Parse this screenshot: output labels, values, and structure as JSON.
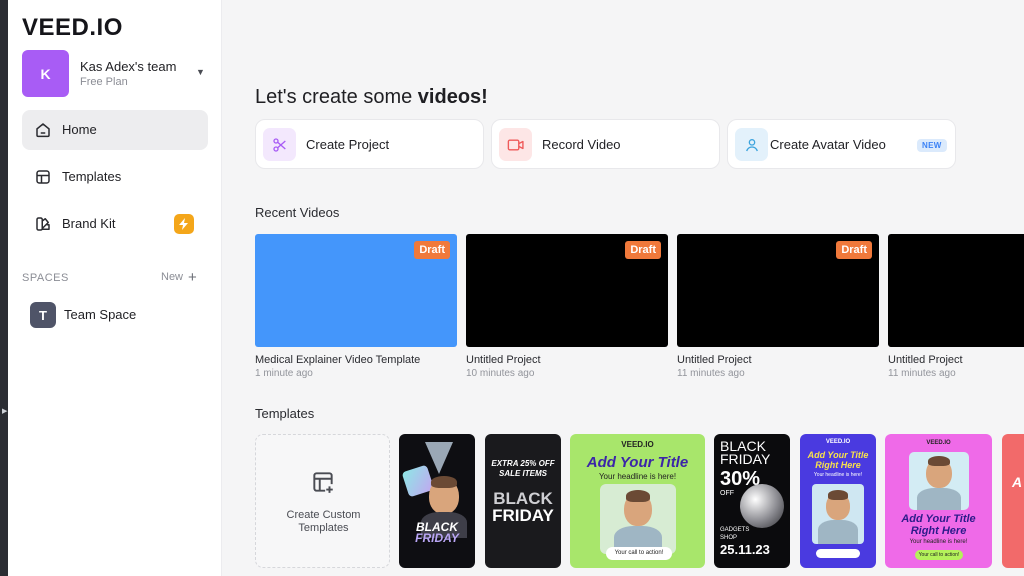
{
  "app": {
    "logo": "VEED.IO"
  },
  "team": {
    "initial": "K",
    "name": "Kas Adex's team",
    "plan": "Free Plan"
  },
  "nav": {
    "home": "Home",
    "templates": "Templates",
    "brand_kit": "Brand Kit"
  },
  "spaces": {
    "title": "SPACES",
    "new_label": "New",
    "items": [
      {
        "initial": "T",
        "label": "Team Space"
      }
    ]
  },
  "main": {
    "heading_prefix": "Let's create some ",
    "heading_bold": "videos!",
    "actions": {
      "create_project": "Create Project",
      "record_video": "Record Video",
      "create_avatar": "Create Avatar Video",
      "new_badge": "NEW"
    },
    "recent_title": "Recent Videos",
    "videos": [
      {
        "title": "Medical Explainer Video Template",
        "time": "1 minute ago",
        "badge": "Draft"
      },
      {
        "title": "Untitled Project",
        "time": "10 minutes ago",
        "badge": "Draft"
      },
      {
        "title": "Untitled Project",
        "time": "11 minutes ago",
        "badge": "Draft"
      },
      {
        "title": "Untitled Project",
        "time": "11 minutes ago"
      }
    ],
    "templates_title": "Templates",
    "custom_template": {
      "line1": "Create Custom",
      "line2": "Templates"
    },
    "tpl_cards": {
      "t2": {
        "l1": "EXTRA 25% OFF",
        "l2": "SALE ITEMS",
        "l3": "BLACK",
        "l4": "FRIDAY"
      },
      "t1": {
        "l1": "BLACK",
        "l2": "FRIDAY"
      },
      "t3": {
        "brand": "VEED.IO",
        "title": "Add Your Title",
        "sub": "Your headline is here!",
        "cta": "Your call to action!"
      },
      "t4": {
        "l1": "BLACK",
        "l2": "FRIDAY",
        "l3": "30%",
        "l4": "OFF",
        "l5": "GADGETS",
        "l6": "SHOP",
        "l7": "25.11.23"
      },
      "t5": {
        "brand": "VEED.IO",
        "title": "Add Your Title",
        "title2": "Right Here",
        "sub": "Your headline is here!"
      },
      "t6": {
        "brand": "VEED.IO",
        "title": "Add Your Title",
        "title2": "Right Here",
        "sub": "Your headline is here!",
        "cta": "Your call to action!"
      },
      "t7": {
        "l1": "A"
      }
    }
  },
  "colors": {
    "accent_purple": "#a85cf5",
    "draft_orange": "#f0793b",
    "first_thumb_blue": "#4496fb",
    "bolt_yellow": "#f4a61a"
  }
}
